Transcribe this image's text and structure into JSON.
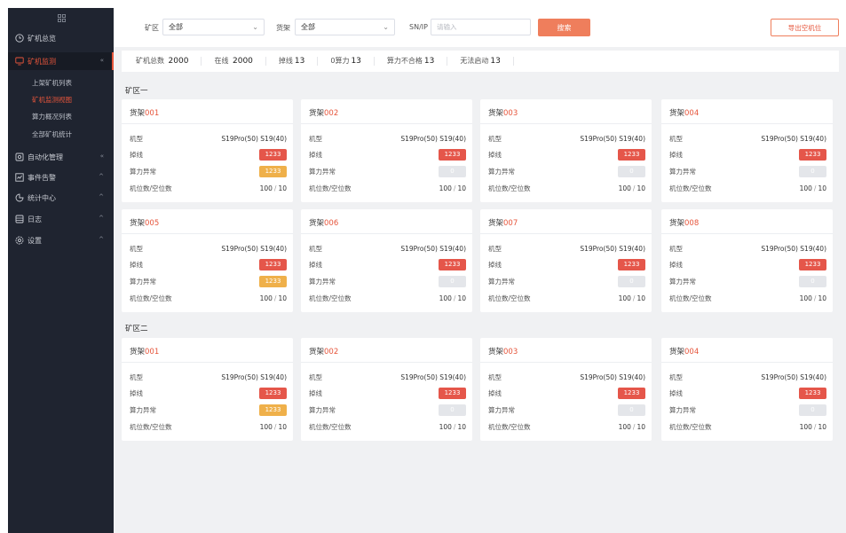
{
  "colors": {
    "accent": "#e6553b",
    "sidebar_bg": "#1f2430",
    "badge_red": "#e5564a",
    "badge_orange": "#efb04a",
    "badge_gray": "#e4e6ea"
  },
  "sidebar": {
    "logo_icon": "grid-logo-icon",
    "items": [
      {
        "label": "矿机总览",
        "icon": "clock-icon",
        "has_arrow": false,
        "active": false
      },
      {
        "label": "矿机监测",
        "icon": "monitor-icon",
        "has_arrow": true,
        "active": true
      },
      {
        "label": "自动化管理",
        "icon": "automation-icon",
        "has_arrow": true,
        "active": false
      },
      {
        "label": "事件告警",
        "icon": "alert-icon",
        "has_arrow": true,
        "active": false
      },
      {
        "label": "统计中心",
        "icon": "stats-icon",
        "has_arrow": true,
        "active": false
      },
      {
        "label": "日志",
        "icon": "log-icon",
        "has_arrow": true,
        "active": false
      },
      {
        "label": "设置",
        "icon": "settings-icon",
        "has_arrow": true,
        "active": false
      }
    ],
    "subitems": [
      {
        "label": "上架矿机列表",
        "active": false
      },
      {
        "label": "矿机监测视图",
        "active": true
      },
      {
        "label": "算力概况列表",
        "active": false
      },
      {
        "label": "全部矿机统计",
        "active": false
      }
    ]
  },
  "filters": {
    "zone_label": "矿区",
    "zone_value": "全部",
    "shelf_label": "货架",
    "shelf_value": "全部",
    "sn_label": "SN/IP",
    "sn_placeholder": "请输入",
    "search_label": "搜索",
    "export_label": "导出空机位"
  },
  "stats": [
    {
      "label": "矿机总数",
      "value": "2000"
    },
    {
      "label": "在线",
      "value": "2000"
    },
    {
      "label": "掉线",
      "value": "13"
    },
    {
      "label": "0算力",
      "value": "13"
    },
    {
      "label": "算力不合格",
      "value": "13"
    },
    {
      "label": "无法启动",
      "value": "13"
    }
  ],
  "row_labels": {
    "model": "机型",
    "offline": "掉线",
    "hash_abnormal": "算力异常",
    "slots": "机位数/空位数"
  },
  "zones": [
    {
      "title": "矿区一",
      "shelves": [
        {
          "prefix": "货架",
          "num": "001",
          "model": "S19Pro(50) S19(40)",
          "offline": "1233",
          "abnormal": "1233",
          "abnormal_style": "orange",
          "slots": "100",
          "empty": "10"
        },
        {
          "prefix": "货架",
          "num": "002",
          "model": "S19Pro(50) S19(40)",
          "offline": "1233",
          "abnormal": "0",
          "abnormal_style": "gray",
          "slots": "100",
          "empty": "10"
        },
        {
          "prefix": "货架",
          "num": "003",
          "model": "S19Pro(50) S19(40)",
          "offline": "1233",
          "abnormal": "0",
          "abnormal_style": "gray",
          "slots": "100",
          "empty": "10"
        },
        {
          "prefix": "货架",
          "num": "004",
          "model": "S19Pro(50) S19(40)",
          "offline": "1233",
          "abnormal": "0",
          "abnormal_style": "gray",
          "slots": "100",
          "empty": "10"
        },
        {
          "prefix": "货架",
          "num": "005",
          "model": "S19Pro(50) S19(40)",
          "offline": "1233",
          "abnormal": "1233",
          "abnormal_style": "orange",
          "slots": "100",
          "empty": "10"
        },
        {
          "prefix": "货架",
          "num": "006",
          "model": "S19Pro(50) S19(40)",
          "offline": "1233",
          "abnormal": "0",
          "abnormal_style": "gray",
          "slots": "100",
          "empty": "10"
        },
        {
          "prefix": "货架",
          "num": "007",
          "model": "S19Pro(50) S19(40)",
          "offline": "1233",
          "abnormal": "0",
          "abnormal_style": "gray",
          "slots": "100",
          "empty": "10"
        },
        {
          "prefix": "货架",
          "num": "008",
          "model": "S19Pro(50) S19(40)",
          "offline": "1233",
          "abnormal": "0",
          "abnormal_style": "gray",
          "slots": "100",
          "empty": "10"
        }
      ]
    },
    {
      "title": "矿区二",
      "shelves": [
        {
          "prefix": "货架",
          "num": "001",
          "model": "S19Pro(50) S19(40)",
          "offline": "1233",
          "abnormal": "1233",
          "abnormal_style": "orange",
          "slots": "100",
          "empty": "10"
        },
        {
          "prefix": "货架",
          "num": "002",
          "model": "S19Pro(50) S19(40)",
          "offline": "1233",
          "abnormal": "0",
          "abnormal_style": "gray",
          "slots": "100",
          "empty": "10"
        },
        {
          "prefix": "货架",
          "num": "003",
          "model": "S19Pro(50) S19(40)",
          "offline": "1233",
          "abnormal": "0",
          "abnormal_style": "gray",
          "slots": "100",
          "empty": "10"
        },
        {
          "prefix": "货架",
          "num": "004",
          "model": "S19Pro(50) S19(40)",
          "offline": "1233",
          "abnormal": "0",
          "abnormal_style": "gray",
          "slots": "100",
          "empty": "10"
        }
      ]
    }
  ]
}
